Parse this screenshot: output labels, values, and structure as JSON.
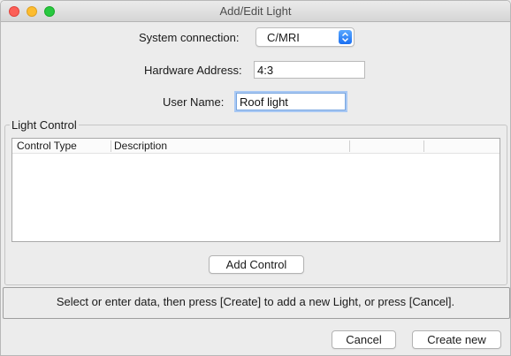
{
  "window": {
    "title": "Add/Edit Light"
  },
  "form": {
    "system_connection_label": "System connection:",
    "system_connection_value": "C/MRI",
    "hardware_address_label": "Hardware Address:",
    "hardware_address_value": "4:3",
    "user_name_label": "User Name:",
    "user_name_value": "Roof light"
  },
  "light_control": {
    "legend": "Light Control",
    "columns": [
      "Control Type",
      "Description",
      "",
      ""
    ],
    "rows": [],
    "add_button": "Add Control"
  },
  "status": "Select or enter data, then press [Create] to add a new Light, or press [Cancel].",
  "buttons": {
    "cancel": "Cancel",
    "create": "Create new"
  }
}
